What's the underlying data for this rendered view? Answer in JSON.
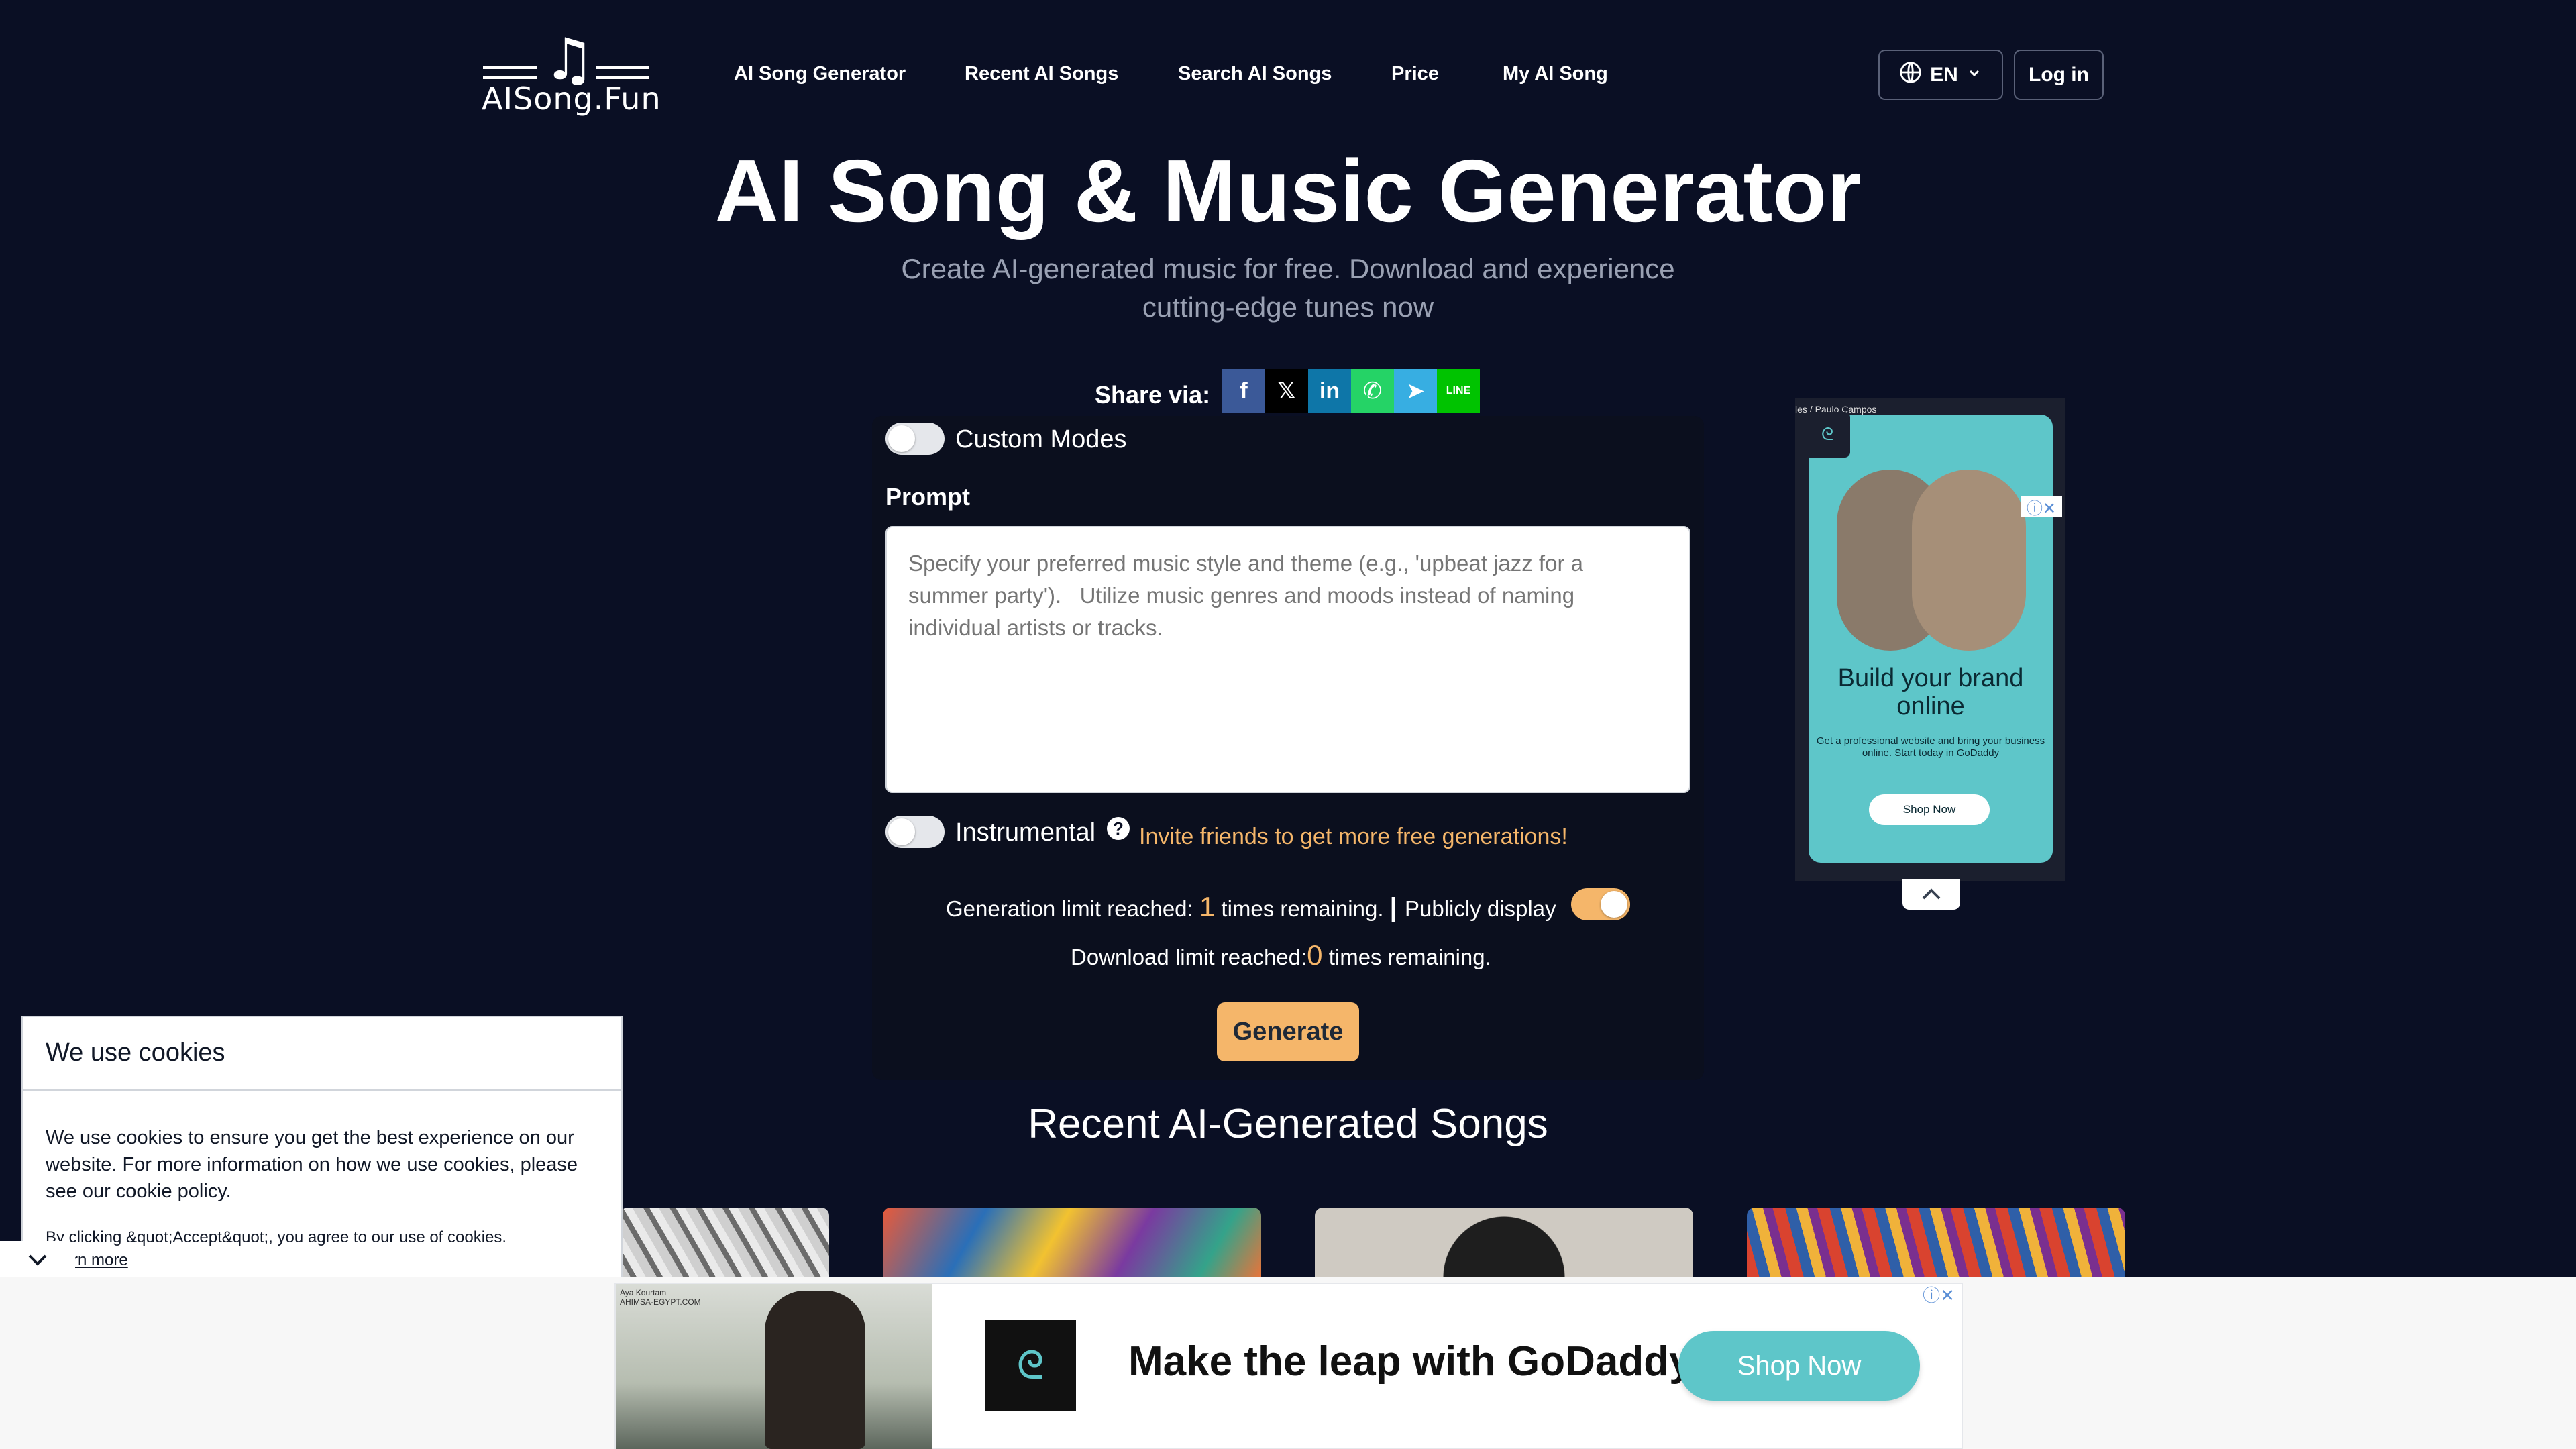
{
  "header": {
    "logo_text": "AISong.Fun",
    "nav": [
      {
        "label": "AI Song Generator"
      },
      {
        "label": "Recent AI Songs"
      },
      {
        "label": "Search AI Songs"
      },
      {
        "label": "Price"
      },
      {
        "label": "My AI Song"
      }
    ],
    "language": "EN",
    "login_label": "Log in"
  },
  "hero": {
    "title": "AI Song & Music Generator",
    "subtitle": "Create AI-generated music for free. Download and experience cutting-edge tunes now"
  },
  "share": {
    "label": "Share via:",
    "icons": [
      {
        "name": "facebook-icon",
        "glyph": "f",
        "color": "#3b5998"
      },
      {
        "name": "x-icon",
        "glyph": "𝕏",
        "color": "#000000"
      },
      {
        "name": "linkedin-icon",
        "glyph": "in",
        "color": "#0e76a8"
      },
      {
        "name": "whatsapp-icon",
        "glyph": "✆",
        "color": "#25d366"
      },
      {
        "name": "telegram-icon",
        "glyph": "➤",
        "color": "#37aee2"
      },
      {
        "name": "line-icon",
        "glyph": "LINE",
        "color": "#00c300"
      }
    ]
  },
  "form": {
    "custom_modes_label": "Custom Modes",
    "custom_modes_on": false,
    "prompt_label": "Prompt",
    "prompt_placeholder": "Specify your preferred music style and theme (e.g., 'upbeat jazz for a summer party').   Utilize music genres and moods instead of naming individual artists or tracks.",
    "instrumental_label": "Instrumental",
    "instrumental_on": false,
    "invite_text": "Invite friends to get more free generations!",
    "generation_limit_prefix": "Generation limit reached:",
    "generation_remaining": "1",
    "generation_limit_suffix": "times remaining.",
    "publicly_display_label": "Publicly display",
    "publicly_display_on": true,
    "download_limit_prefix": "Download limit reached:",
    "download_remaining": "0",
    "download_limit_suffix": "times remaining.",
    "generate_label": "Generate"
  },
  "recent": {
    "title": "Recent AI-Generated Songs"
  },
  "side_ad": {
    "credit": "les / Paulo Campos",
    "title": "Build your brand online",
    "text": "Get a professional website and bring your business online. Start today in GoDaddy",
    "button": "Shop Now"
  },
  "cookie": {
    "title": "We use cookies",
    "body": "We use cookies to ensure you get the best experience on our website. For more information on how we use cookies, please see our cookie policy.",
    "consent": "By clicking &quot;Accept&quot;, you agree to our use of cookies.",
    "learn_more": "Learn more"
  },
  "bottom_ad": {
    "credit": "Aya Kourtam\nAHIMSA-EGYPT.COM",
    "headline": "Make the leap with GoDaddy",
    "button": "Shop Now"
  }
}
